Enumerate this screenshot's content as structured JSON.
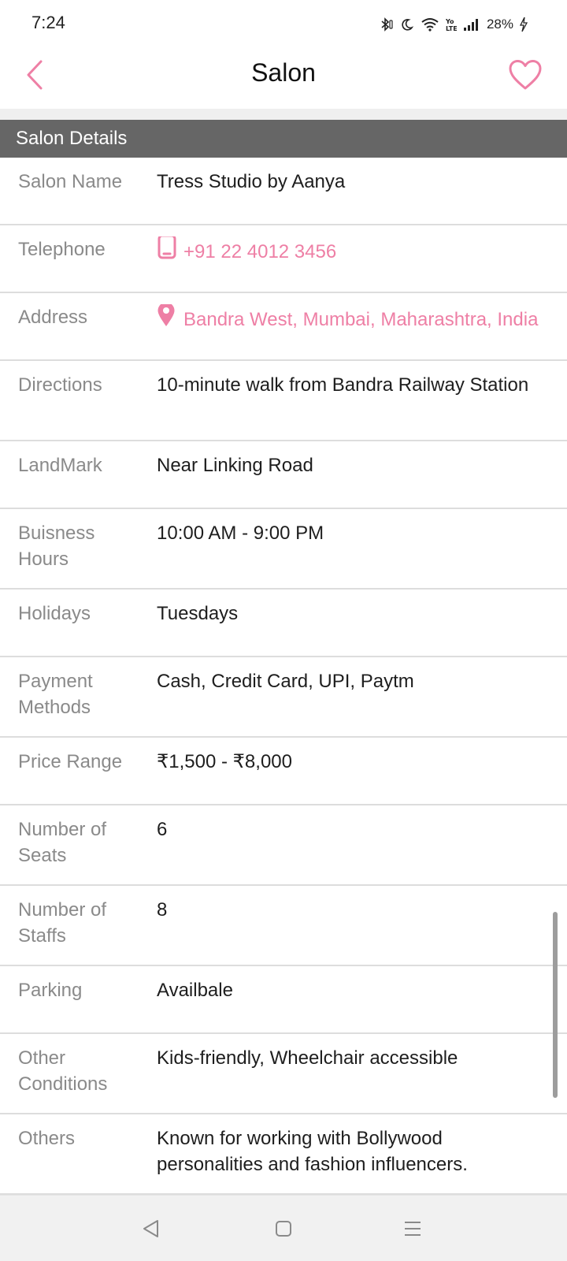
{
  "status_bar": {
    "time": "7:24",
    "battery": "28%",
    "icons": [
      "bluetooth-icon",
      "moon-icon",
      "wifi-icon",
      "volte-icon",
      "signal-icon",
      "battery-charging-icon"
    ]
  },
  "header": {
    "title": "Salon",
    "back_icon": "chevron-left-icon",
    "favorite_icon": "heart-outline-icon"
  },
  "section": {
    "title": "Salon Details"
  },
  "details": [
    {
      "label": "Salon Name",
      "value": "Tress Studio by Aanya"
    },
    {
      "label": "Telephone",
      "value": "+91 22 4012 3456",
      "icon": "phone-icon"
    },
    {
      "label": "Address",
      "value": "Bandra West, Mumbai, Maharashtra, India",
      "icon": "map-pin-icon"
    },
    {
      "label": "Directions",
      "value": "10-minute walk from Bandra Railway Station"
    },
    {
      "label": "LandMark",
      "value": "Near Linking Road"
    },
    {
      "label": "Buisness Hours",
      "value": "10:00 AM - 9:00 PM"
    },
    {
      "label": "Holidays",
      "value": "Tuesdays"
    },
    {
      "label": "Payment Methods",
      "value": "Cash, Credit Card, UPI, Paytm"
    },
    {
      "label": "Price Range",
      "value": "₹1,500 - ₹8,000"
    },
    {
      "label": "Number of Seats",
      "value": "6"
    },
    {
      "label": "Number of Staffs",
      "value": "8"
    },
    {
      "label": "Parking",
      "value": "Availbale"
    },
    {
      "label": "Other Conditions",
      "value": "Kids-friendly, Wheelchair accessible"
    },
    {
      "label": "Others",
      "value": "Known for working with Bollywood personalities and fashion influencers."
    }
  ],
  "colors": {
    "accent": "#ee7fa5",
    "section_header_bg": "#666666",
    "label_text": "#8a8a8a",
    "divider": "#dddddd"
  },
  "nav_bar": {
    "icons": [
      "nav-back-icon",
      "nav-home-icon",
      "nav-menu-icon"
    ]
  }
}
